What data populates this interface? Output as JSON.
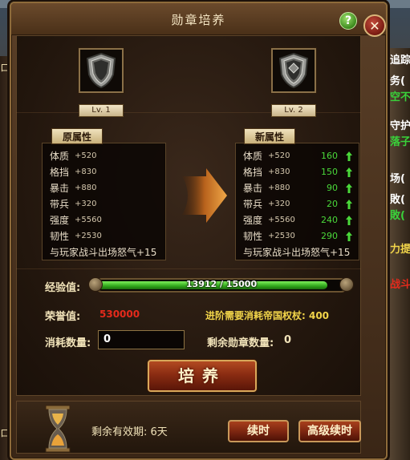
{
  "background": {
    "left_fragments": [
      "ロ",
      "ロ"
    ],
    "right_fragments": [
      {
        "text": "追踪",
        "color": "#ffffff"
      },
      {
        "text": "务(",
        "color": "#ffffff"
      },
      {
        "text": "空不",
        "color": "#39d13a"
      },
      {
        "text": "守护",
        "color": "#ffffff"
      },
      {
        "text": "落子",
        "color": "#39d13a"
      },
      {
        "text": "场(",
        "color": "#ffffff"
      },
      {
        "text": "敗(",
        "color": "#ffffff"
      },
      {
        "text": "敗(",
        "color": "#39d13a"
      },
      {
        "text": "力提",
        "color": "#f2d54a"
      },
      {
        "text": "战斗",
        "color": "#e52a1c"
      }
    ]
  },
  "dialog": {
    "title": "勋章培养",
    "help_label": "?",
    "close_label": "✕"
  },
  "medals": {
    "current": {
      "level_label": "Lv. 1",
      "icon": "shield-medal-icon"
    },
    "next": {
      "level_label": "Lv. 2",
      "icon": "shield-medal-icon"
    }
  },
  "original_attributes": {
    "header": "原属性",
    "rows": [
      {
        "name": "体质",
        "value": "+520"
      },
      {
        "name": "格挡",
        "value": "+830"
      },
      {
        "name": "暴击",
        "value": "+880"
      },
      {
        "name": "带兵",
        "value": "+320"
      },
      {
        "name": "强度",
        "value": "+5560"
      },
      {
        "name": "韧性",
        "value": "+2530"
      }
    ],
    "footer": "与玩家战斗出场怒气+15"
  },
  "new_attributes": {
    "header": "新属性",
    "rows": [
      {
        "name": "体质",
        "value": "+520",
        "delta": "160"
      },
      {
        "name": "格挡",
        "value": "+830",
        "delta": "150"
      },
      {
        "name": "暴击",
        "value": "+880",
        "delta": "90"
      },
      {
        "name": "带兵",
        "value": "+320",
        "delta": "20"
      },
      {
        "name": "强度",
        "value": "+5560",
        "delta": "240"
      },
      {
        "name": "韧性",
        "value": "+2530",
        "delta": "290"
      }
    ],
    "footer": "与玩家战斗出场怒气+15"
  },
  "experience": {
    "label": "经验值:",
    "text": "13912 / 15000",
    "current": 13912,
    "max": 15000
  },
  "honor": {
    "label": "荣誉值:",
    "value": "530000"
  },
  "upgrade_cost": {
    "text": "进阶需要消耗帝国权杖: 400"
  },
  "consume": {
    "label": "消耗数量:",
    "value": "0"
  },
  "remaining": {
    "label": "剩余勋章数量:",
    "value": "0"
  },
  "train_button": "培养",
  "validity": {
    "label": "剩余有效期:",
    "value": "6天"
  },
  "renew_button": "续时",
  "advanced_renew_button": "高级续时",
  "colors": {
    "delta_green": "#4ad83a",
    "honor_red": "#e52a1c",
    "cost_yellow": "#f2d54a",
    "accent_gold": "#d8a85a"
  }
}
